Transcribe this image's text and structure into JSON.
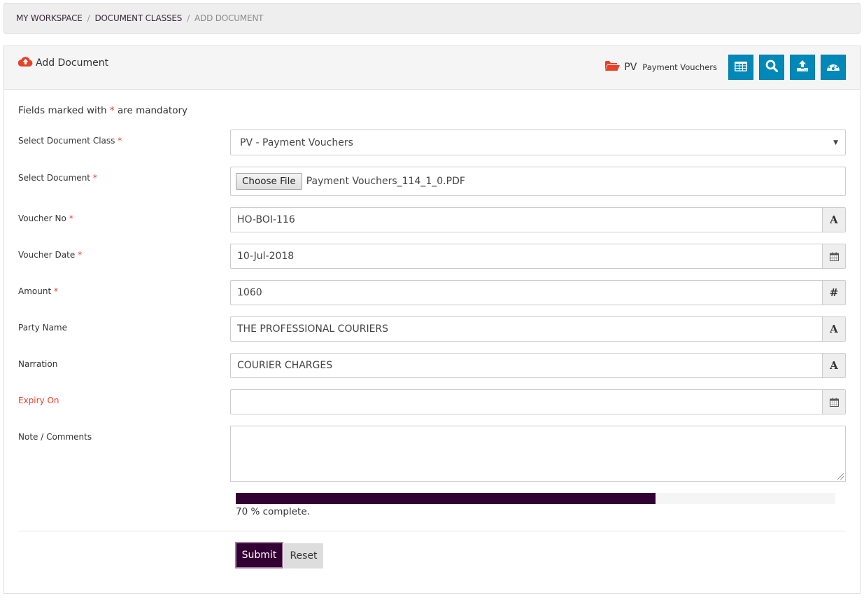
{
  "breadcrumb": {
    "items": [
      "MY WORKSPACE",
      "DOCUMENT CLASSES",
      "ADD DOCUMENT"
    ],
    "separator": "/"
  },
  "panel": {
    "title": "Add Document",
    "title_icon": "cloud-upload-icon",
    "class_icon": "folder-open-icon",
    "class_code": "PV",
    "class_name": "Payment Vouchers",
    "tools": [
      {
        "name": "table-view",
        "icon": "table-icon"
      },
      {
        "name": "search",
        "icon": "search-icon"
      },
      {
        "name": "upload",
        "icon": "upload-icon"
      },
      {
        "name": "dashboard",
        "icon": "dashboard-icon"
      }
    ]
  },
  "form": {
    "mandatory_note_prefix": "Fields marked with",
    "mandatory_star": "*",
    "mandatory_note_suffix": "are mandatory",
    "document_class": {
      "label": "Select Document Class",
      "required": "*",
      "value": "PV - Payment Vouchers"
    },
    "document": {
      "label": "Select Document",
      "required": "*",
      "button": "Choose File",
      "file_name": "Payment Vouchers_114_1_0.PDF"
    },
    "voucher_no": {
      "label": "Voucher No",
      "required": "*",
      "value": "HO-BOI-116",
      "addon": "A"
    },
    "voucher_date": {
      "label": "Voucher Date",
      "required": "*",
      "value": "10-Jul-2018",
      "addon_icon": "calendar-icon"
    },
    "amount": {
      "label": "Amount",
      "required": "*",
      "value": "1060",
      "addon": "#"
    },
    "party_name": {
      "label": "Party Name",
      "value": "THE PROFESSIONAL COURIERS",
      "addon": "A"
    },
    "narration": {
      "label": "Narration",
      "value": "COURIER CHARGES",
      "addon": "A"
    },
    "expiry_on": {
      "label": "Expiry On",
      "value": "",
      "addon_icon": "calendar-icon"
    },
    "comments": {
      "label": "Note / Comments",
      "value": ""
    }
  },
  "progress": {
    "percent": 70,
    "text": "70 % complete."
  },
  "actions": {
    "submit": "Submit",
    "reset": "Reset"
  },
  "colors": {
    "accent": "#330033",
    "tool_button": "#0089b8",
    "required": "#e8402a"
  }
}
